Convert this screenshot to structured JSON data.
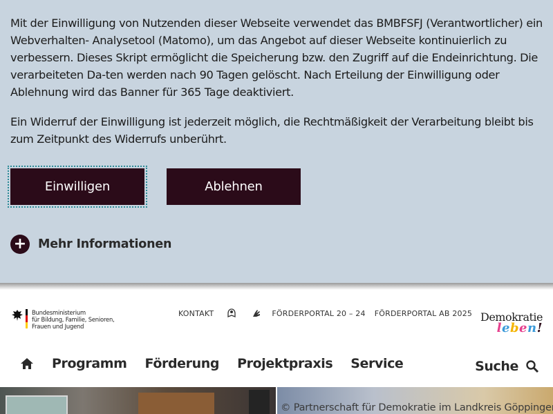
{
  "consent": {
    "paragraph1": "Mit der Einwilligung von Nutzenden dieser Webseite verwendet das BMBFSFJ (Verantwortlicher) ein Webverhalten- Analysetool (Matomo), um das Angebot auf dieser Webseite kontinuierlich zu verbessern. Dieses Skript ermöglicht die Speicherung bzw. den Zugriff auf die Endeinrichtung. Die verarbeiteten Da-ten werden nach 90 Tagen gelöscht. Nach Erteilung der Einwilligung oder Ablehnung wird das Banner für 365 Tage deaktiviert.",
    "paragraph2": "Ein Widerruf der Einwilligung ist jederzeit möglich, die Rechtmäßigkeit der Verarbeitung bleibt bis zum Zeitpunkt des Widerrufs unberührt.",
    "accept_label": "Einwilligen",
    "decline_label": "Ablehnen",
    "more_label": "Mehr Informationen",
    "more_icon": "+"
  },
  "header": {
    "ministry_name": "Bundesministerium für Bildung, Familie, Senioren, Frauen und Jugend",
    "ministry_lines": [
      "Bundesministerium",
      "für Bildung, Familie, Senioren,",
      "Frauen und Jugend"
    ],
    "utility_links": {
      "contact": "KONTAKT",
      "portal_old": "FÖRDERPORTAL 20 – 24",
      "portal_new": "FÖRDERPORTAL AB 2025"
    },
    "logo_line1": "Demokratie",
    "logo_line2_letters": [
      "l",
      "e",
      "b",
      "e",
      "n",
      "!"
    ]
  },
  "nav": {
    "items": [
      "Programm",
      "Förderung",
      "Projektpraxis",
      "Service"
    ],
    "search_label": "Suche"
  },
  "hero": {
    "credit": "© Partnerschaft für Demokratie im Landkreis Göppingen"
  },
  "colors": {
    "banner_bg": "#c8d4df",
    "button_bg": "#2b0b19",
    "focus_outline": "#2b8a96"
  }
}
